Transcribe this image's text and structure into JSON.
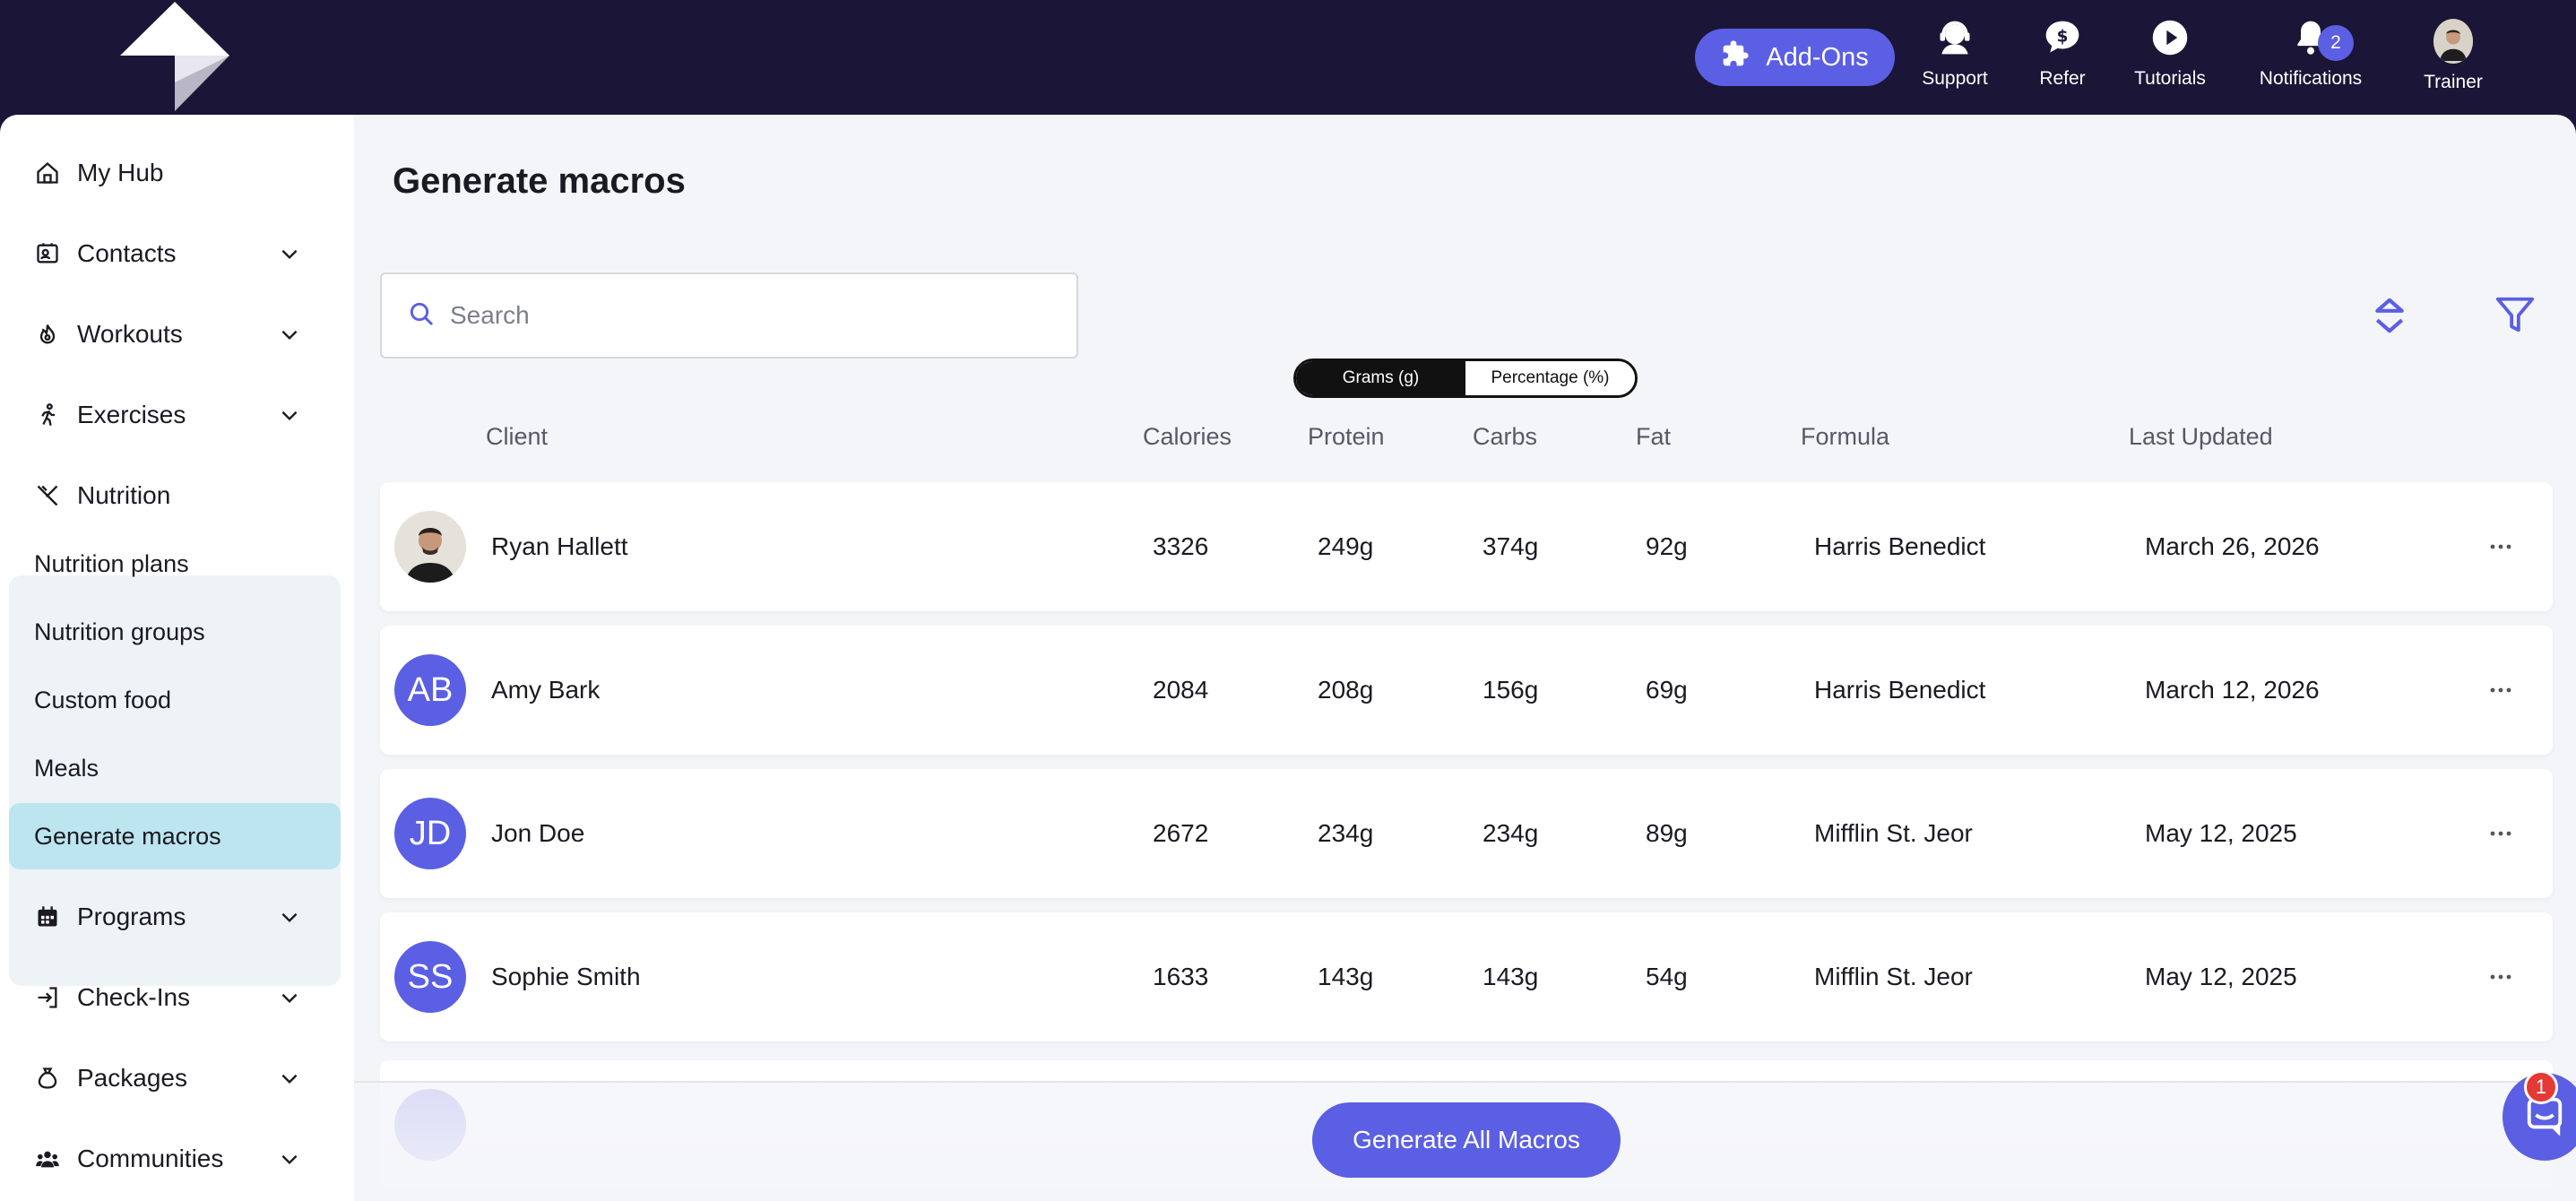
{
  "header": {
    "addons_label": "Add-Ons",
    "nav": [
      {
        "label": "Support",
        "icon": "support-icon"
      },
      {
        "label": "Refer",
        "icon": "dollar-chat-icon"
      },
      {
        "label": "Tutorials",
        "icon": "play-icon"
      },
      {
        "label": "Notifications",
        "icon": "bell-icon",
        "badge": "2"
      },
      {
        "label": "Trainer",
        "icon": "avatar"
      }
    ]
  },
  "sidebar": {
    "items": [
      {
        "label": "My Hub",
        "icon": "home-icon"
      },
      {
        "label": "Contacts",
        "icon": "contacts-icon"
      },
      {
        "label": "Workouts",
        "icon": "flame-icon"
      },
      {
        "label": "Exercises",
        "icon": "running-icon"
      },
      {
        "label": "Nutrition",
        "icon": "utensils-icon"
      },
      {
        "label": "Programs",
        "icon": "calendar-icon"
      },
      {
        "label": "Check-Ins",
        "icon": "login-icon"
      },
      {
        "label": "Packages",
        "icon": "moneybag-icon"
      },
      {
        "label": "Communities",
        "icon": "users-icon"
      }
    ],
    "nutrition_sub": [
      "Nutrition plans",
      "Nutrition groups",
      "Custom food",
      "Meals",
      "Generate macros"
    ]
  },
  "main": {
    "title": "Generate macros",
    "search_placeholder": "Search",
    "toggle": {
      "grams": "Grams (g)",
      "percentage": "Percentage (%)"
    },
    "columns": [
      "Client",
      "Calories",
      "Protein",
      "Carbs",
      "Fat",
      "Formula",
      "Last Updated"
    ],
    "rows": [
      {
        "initials": "",
        "name": "Ryan Hallett",
        "calories": "3326",
        "protein": "249g",
        "carbs": "374g",
        "fat": "92g",
        "formula": "Harris Benedict",
        "updated": "March 26, 2026"
      },
      {
        "initials": "AB",
        "name": "Amy Bark",
        "calories": "2084",
        "protein": "208g",
        "carbs": "156g",
        "fat": "69g",
        "formula": "Harris Benedict",
        "updated": "March 12, 2026"
      },
      {
        "initials": "JD",
        "name": "Jon Doe",
        "calories": "2672",
        "protein": "234g",
        "carbs": "234g",
        "fat": "89g",
        "formula": "Mifflin St. Jeor",
        "updated": "May 12, 2025"
      },
      {
        "initials": "SS",
        "name": "Sophie Smith",
        "calories": "1633",
        "protein": "143g",
        "carbs": "143g",
        "fat": "54g",
        "formula": "Mifflin St. Jeor",
        "updated": "May 12, 2025"
      }
    ],
    "generate_all_label": "Generate All Macros",
    "chat_badge": "1"
  },
  "colors": {
    "accent": "#5b5fe3",
    "topbar": "#1b1537",
    "active_sub": "#bde5ef"
  }
}
